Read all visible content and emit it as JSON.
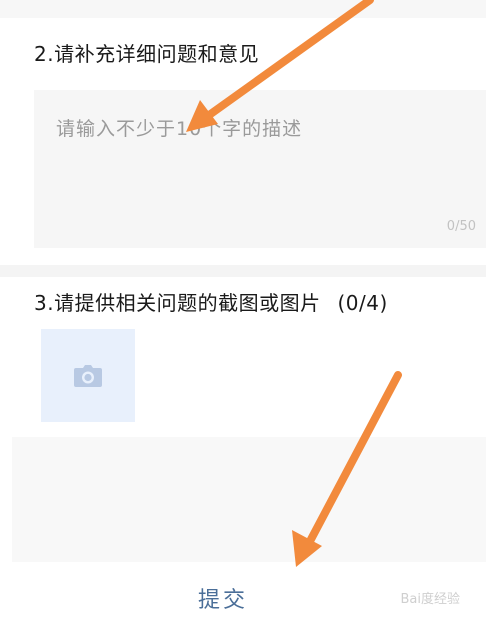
{
  "sections": {
    "details_title": "2.请补充详细问题和意见",
    "details_placeholder": "请输入不少于10个字的描述",
    "details_counter": "0/50",
    "screenshots_title": "3.请提供相关问题的截图或图片",
    "screenshots_count": "(0/4)"
  },
  "footer": {
    "submit_label": "提交"
  },
  "icons": {
    "upload": "camera-icon"
  },
  "colors": {
    "accent": "#4a6e98",
    "photo_tile": "#e8f0fc",
    "annotation_arrow": "#f28a3c"
  },
  "watermark": "Bai度经验"
}
